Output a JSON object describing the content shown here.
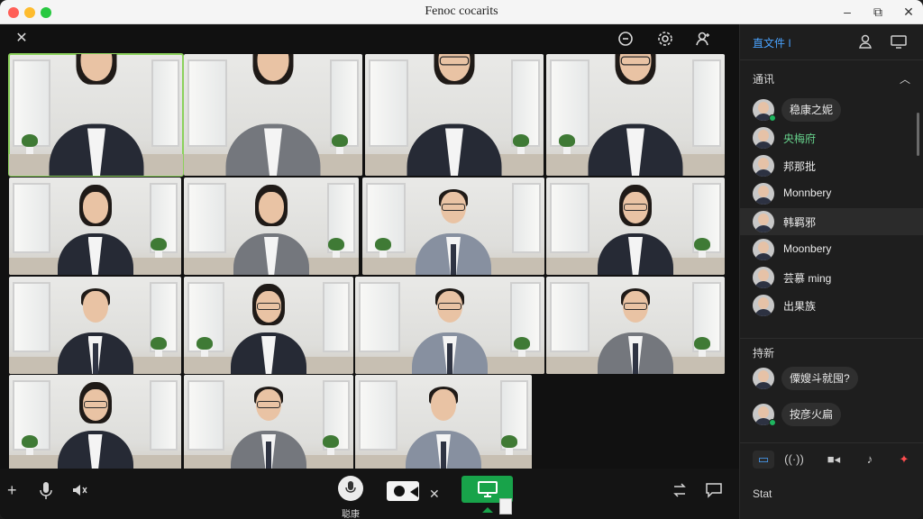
{
  "window": {
    "title": "Fenoc cocarits",
    "controls": [
      "–",
      "⧉",
      "✕"
    ]
  },
  "toolbar": {
    "close_glyph": "✕",
    "icons": [
      "record-icon",
      "settings-icon",
      "user-icon"
    ]
  },
  "grid": {
    "tiles": [
      {
        "hair": "long",
        "glasses": false,
        "body": "dark",
        "active": true
      },
      {
        "hair": "long",
        "glasses": false,
        "body": "grey"
      },
      {
        "hair": "long",
        "glasses": true,
        "body": "dark"
      },
      {
        "hair": "long",
        "glasses": true,
        "body": "dark"
      },
      {
        "hair": "long",
        "glasses": false,
        "body": "dark"
      },
      {
        "hair": "long",
        "glasses": false,
        "body": "grey"
      },
      {
        "hair": "short",
        "glasses": true,
        "body": "light"
      },
      {
        "hair": "long",
        "glasses": true,
        "body": "dark"
      },
      {
        "hair": "short",
        "glasses": false,
        "body": "dark"
      },
      {
        "hair": "long",
        "glasses": true,
        "body": "dark"
      },
      {
        "hair": "short",
        "glasses": true,
        "body": "light"
      },
      {
        "hair": "short",
        "glasses": true,
        "body": "grey"
      },
      {
        "hair": "long",
        "glasses": true,
        "body": "dark"
      },
      {
        "hair": "short",
        "glasses": true,
        "body": "grey"
      },
      {
        "hair": "short",
        "glasses": false,
        "body": "light"
      }
    ]
  },
  "bottom_bar": {
    "mic_label": "聪康",
    "close_glyph": "✕"
  },
  "sidebar": {
    "header_title": "直文件 I",
    "section_participants": "通讯",
    "participants": [
      {
        "name": "稳康之妮",
        "style": "pill",
        "online": true
      },
      {
        "name": "央梅府",
        "style": "green",
        "online": false
      },
      {
        "name": "邦那批",
        "style": "plain",
        "online": false
      },
      {
        "name": "Monnbery",
        "style": "plain",
        "online": false
      },
      {
        "name": "韩羁邪",
        "style": "plain",
        "online": false,
        "selected": true
      },
      {
        "name": "Moonbery",
        "style": "plain",
        "online": false
      },
      {
        "name": "芸慕 ming",
        "style": "plain",
        "online": false
      },
      {
        "name": "出果族",
        "style": "plain",
        "online": false
      }
    ],
    "section_messages": "持新",
    "messages": [
      {
        "text": "僳嫂斗就囤?",
        "online": false
      },
      {
        "text": "按彦火扁",
        "online": true
      }
    ],
    "footer_label": "Stat"
  },
  "colors": {
    "accent_blue": "#4aa3ff",
    "share_green": "#18a34a",
    "online_green": "#1fb55f",
    "active_tile_outline": "#8bd15c"
  }
}
